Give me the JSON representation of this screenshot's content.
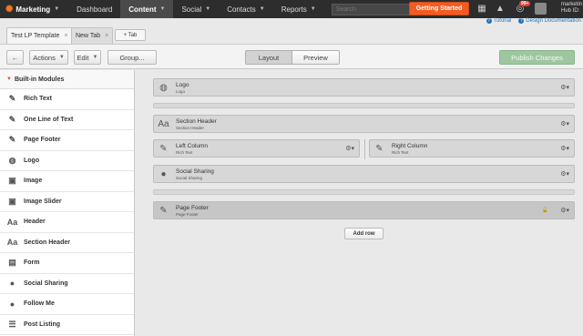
{
  "topnav": {
    "brand": "Marketing",
    "items": [
      "Dashboard",
      "Content",
      "Social",
      "Contacts",
      "Reports"
    ],
    "search_placeholder": "Search",
    "getting_started": "Getting Started",
    "notification_count": "99+",
    "user_name": "marketin",
    "hub_id": "Hub ID:"
  },
  "help": {
    "tutorial": "Tutorial",
    "design_docs": "Design Documentation"
  },
  "tabs": [
    {
      "label": "Test LP Template",
      "close": "×"
    },
    {
      "label": "New Tab",
      "close": "×"
    }
  ],
  "plus_tab": "+ Tab",
  "toolbar": {
    "back": "←",
    "actions": "Actions",
    "edit": "Edit",
    "group": "Group...",
    "layout": "Layout",
    "preview": "Preview",
    "publish": "Publish Changes"
  },
  "sidebar": {
    "header": "Built-in Modules",
    "items": [
      {
        "label": "Rich Text",
        "icon": "edit-icon"
      },
      {
        "label": "One Line of Text",
        "icon": "edit-icon"
      },
      {
        "label": "Page Footer",
        "icon": "edit-icon"
      },
      {
        "label": "Logo",
        "icon": "globe-icon"
      },
      {
        "label": "Image",
        "icon": "image-icon"
      },
      {
        "label": "Image Slider",
        "icon": "image-icon"
      },
      {
        "label": "Header",
        "icon": "text-size-icon"
      },
      {
        "label": "Section Header",
        "icon": "text-size-icon"
      },
      {
        "label": "Form",
        "icon": "form-icon"
      },
      {
        "label": "Social Sharing",
        "icon": "speech-bubble-icon"
      },
      {
        "label": "Follow Me",
        "icon": "speech-bubble-icon"
      },
      {
        "label": "Post Listing",
        "icon": "list-icon"
      }
    ]
  },
  "canvas": {
    "logo": {
      "title": "Logo",
      "sub": "Logo"
    },
    "section_header": {
      "title": "Section Header",
      "sub": "Section Header"
    },
    "left_column": {
      "title": "Left Column",
      "sub": "Rich Text"
    },
    "right_column": {
      "title": "Right Column",
      "sub": "Rich Text"
    },
    "social_sharing": {
      "title": "Social Sharing",
      "sub": "Social Sharing"
    },
    "page_footer": {
      "title": "Page Footer",
      "sub": "Page Footer"
    },
    "add_row": "Add row"
  },
  "colors": {
    "accent": "#f05c22",
    "nav_bg": "#2d2d2d",
    "publish": "#9ec79f",
    "link": "#1e73be"
  }
}
